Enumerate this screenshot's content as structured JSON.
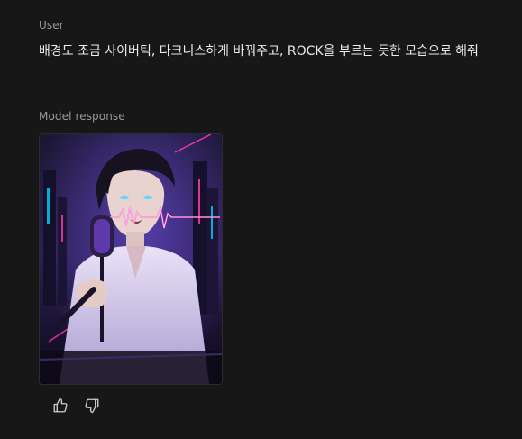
{
  "conversation": {
    "user_label": "User",
    "user_message": "배경도 조금 사이버틱, 다크니스하게 바꿔주고, ROCK을 부르는 듯한 모습으로 해줘",
    "model_label": "Model response",
    "image": {
      "icon": "generated-image",
      "accent_colors": [
        "#ff3da8",
        "#8a4dff",
        "#00e0ff"
      ]
    }
  },
  "feedback": {
    "thumbs_up_icon": "thumbs-up-icon",
    "thumbs_down_icon": "thumbs-down-icon"
  }
}
